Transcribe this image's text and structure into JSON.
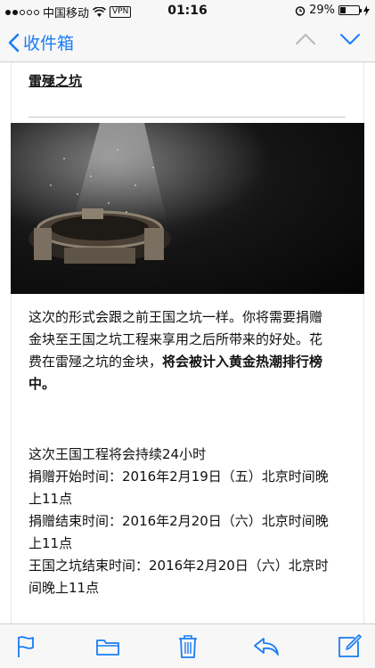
{
  "status_bar": {
    "carrier": "中国移动",
    "vpn": "VPN",
    "time": "01:16",
    "battery_percent": "29%",
    "battery_level": 0.29
  },
  "nav": {
    "back_label": "收件箱"
  },
  "email": {
    "section_title": "雷殛之坑",
    "paragraph1": {
      "line1": "这次的形式会跟之前王国之坑一样。你将需要捐赠",
      "line2": "金块至王国之坑工程来享用之后所带来的好处。花",
      "line3_normal": "费在雷殛之坑的金块，",
      "line3_bold": "将会被计入黄金热潮排行榜",
      "line4_bold": "中。"
    },
    "paragraph2": {
      "duration": "这次王国工程将会持续24小时",
      "start_line1": "捐赠开始时间：2016年2月19日（五）北京时间晚",
      "start_line2": "上11点",
      "end_line1": "捐赠结束时间：2016年2月20日（六）北京时间晚",
      "end_line2": "上11点",
      "pit_end_line1": "王国之坑结束时间：2016年2月20日（六）北京时",
      "pit_end_line2": "间晚上11点"
    }
  },
  "colors": {
    "accent": "#1a7cf5",
    "bar_bg": "#f7f7f7"
  },
  "toolbar": {
    "icons": [
      "flag-icon",
      "folder-icon",
      "trash-icon",
      "reply-icon",
      "compose-icon"
    ]
  }
}
